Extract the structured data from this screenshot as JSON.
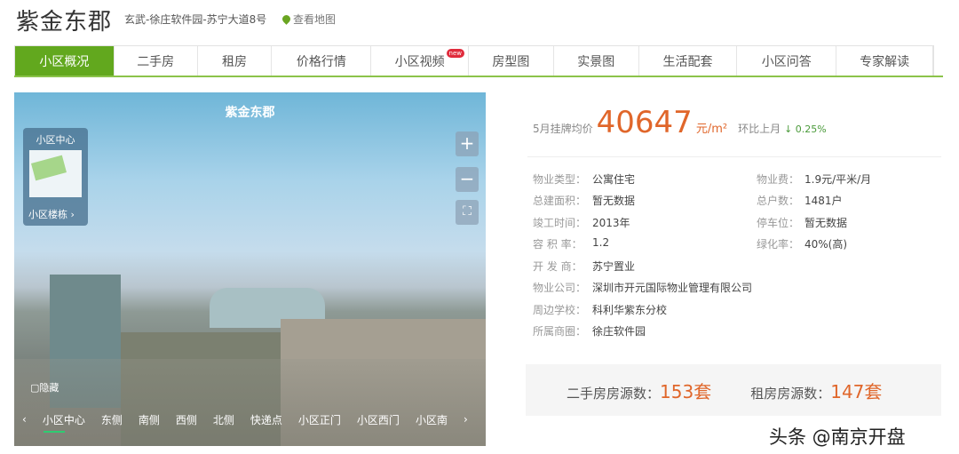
{
  "header": {
    "title": "紫金东郡",
    "address": "玄武-徐庄软件园-苏宁大道8号",
    "map_link": "查看地图"
  },
  "tabs": [
    {
      "label": "小区概况",
      "active": true
    },
    {
      "label": "二手房"
    },
    {
      "label": "租房"
    },
    {
      "label": "价格行情"
    },
    {
      "label": "小区视频",
      "badge": "new"
    },
    {
      "label": "房型图"
    },
    {
      "label": "实景图"
    },
    {
      "label": "生活配套"
    },
    {
      "label": "小区问答"
    },
    {
      "label": "专家解读"
    }
  ],
  "panorama": {
    "title": "紫金东郡",
    "minimap_top": "小区中心",
    "minimap_bottom": "小区楼栋 ›",
    "zoom_in": "+",
    "zoom_out": "−",
    "fullscreen": "⛶",
    "label": "▢隐藏",
    "prev": "‹",
    "next": "›",
    "views": [
      "小区中心",
      "东侧",
      "南侧",
      "西侧",
      "北侧",
      "快递点",
      "小区正门",
      "小区西门",
      "小区南"
    ]
  },
  "price": {
    "label": "5月挂牌均价",
    "value": "40647",
    "unit": "元/m²",
    "compare_label": "环比上月",
    "change": "↓ 0.25%"
  },
  "details": [
    {
      "label": "物业类型：",
      "value": "公寓住宅"
    },
    {
      "label": "物业费：",
      "value": "1.9元/平米/月"
    },
    {
      "label": "总建面积：",
      "value": "暂无数据"
    },
    {
      "label": "总户数：",
      "value": "1481户"
    },
    {
      "label": "竣工时间：",
      "value": "2013年"
    },
    {
      "label": "停车位：",
      "value": "暂无数据"
    },
    {
      "label": "容 积 率：",
      "value": "1.2"
    },
    {
      "label": "绿化率：",
      "value": "40%(高)"
    },
    {
      "label": "开 发 商：",
      "value": "苏宁置业"
    },
    {
      "label": "物业公司：",
      "value": "深圳市开元国际物业管理有限公司"
    },
    {
      "label": "周边学校：",
      "value": "科利华紫东分校"
    },
    {
      "label": "所属商圈：",
      "value": "徐庄软件园"
    }
  ],
  "counts": {
    "resale_label": "二手房房源数：",
    "resale_value": "153套",
    "rent_label": "租房房源数：",
    "rent_value": "147套"
  },
  "watermark": "头条 @南京开盘",
  "colors": {
    "accent": "#62a81e",
    "price": "#e0662a"
  }
}
